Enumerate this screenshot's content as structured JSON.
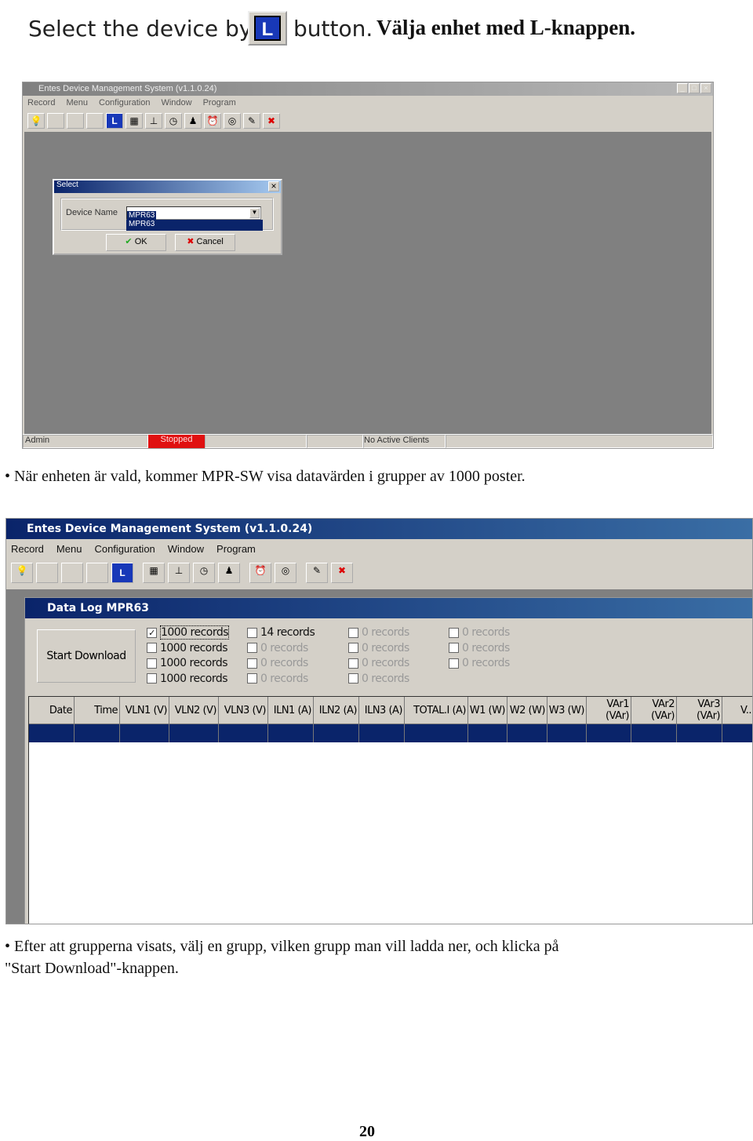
{
  "heading": {
    "en_before": "Select the device by",
    "button_label": "L",
    "en_after": "button.",
    "sv": "Välja enhet med L-knappen."
  },
  "screen1": {
    "title": "Entes Device Management System  (v1.1.0.24)",
    "menu": [
      "Record",
      "Menu",
      "Configuration",
      "Window",
      "Program"
    ],
    "dialog": {
      "title": "Select",
      "field_label": "Device Name",
      "value": "MPR63",
      "dropdown_option": "MPR63",
      "ok": "OK",
      "cancel": "Cancel"
    },
    "status": {
      "user": "Admin",
      "state": "Stopped",
      "clients": "No Active Clients"
    },
    "colors": {
      "state": "#e01010"
    }
  },
  "para1": "• När enheten är vald, kommer MPR-SW visa datavärden i grupper av 1000 poster.",
  "screen2": {
    "title": "Entes Device Management System  (v1.1.0.24)",
    "menu": [
      "Record",
      "Menu",
      "Configuration",
      "Window",
      "Program"
    ],
    "child_title": "Data Log MPR63",
    "start_download": "Start Download",
    "groups": [
      [
        {
          "label": "1000 records",
          "checked": true
        },
        {
          "label": "1000 records",
          "checked": false
        },
        {
          "label": "1000 records",
          "checked": false
        },
        {
          "label": "1000 records",
          "checked": false
        }
      ],
      [
        {
          "label": "14 records",
          "checked": false
        },
        {
          "label": "0 records",
          "checked": false,
          "disabled": true
        },
        {
          "label": "0 records",
          "checked": false,
          "disabled": true
        },
        {
          "label": "0 records",
          "checked": false,
          "disabled": true
        }
      ],
      [
        {
          "label": "0 records",
          "checked": false,
          "disabled": true
        },
        {
          "label": "0 records",
          "checked": false,
          "disabled": true
        },
        {
          "label": "0 records",
          "checked": false,
          "disabled": true
        },
        {
          "label": "0 records",
          "checked": false,
          "disabled": true
        }
      ],
      [
        {
          "label": "0 records",
          "checked": false,
          "disabled": true
        },
        {
          "label": "0 records",
          "checked": false,
          "disabled": true
        },
        {
          "label": "0 records",
          "checked": false,
          "disabled": true
        }
      ]
    ],
    "columns": [
      "Date",
      "Time",
      "VLN1 (V)",
      "VLN2 (V)",
      "VLN3 (V)",
      "ILN1 (A)",
      "ILN2 (A)",
      "ILN3 (A)",
      "TOTAL.I (A)",
      "W1 (W)",
      "W2 (W)",
      "W3 (W)",
      "VAr1 (VAr)",
      "VAr2 (VAr)",
      "VAr3 (VAr)",
      "V.."
    ],
    "colors": {
      "title_bar": "#0a246a",
      "selected_row": "#0a246a"
    }
  },
  "para2": [
    "• Efter att grupperna visats, välj en grupp, vilken grupp man vill ladda ner, och klicka på",
    "\"Start Download\"-knappen."
  ],
  "page_number": "20"
}
